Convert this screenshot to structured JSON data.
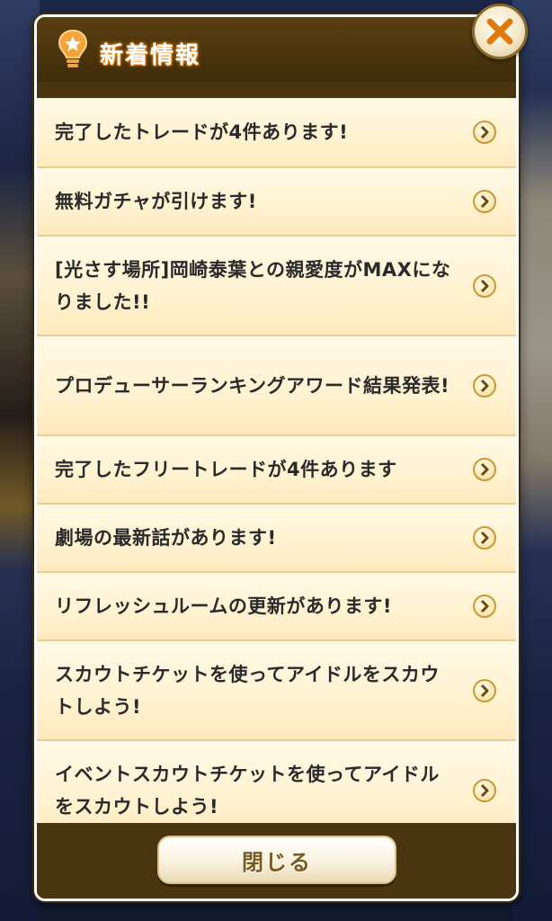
{
  "header": {
    "title": "新着情報",
    "icon": "lightbulb-star-icon"
  },
  "close_icon": "close-x-icon",
  "items": [
    {
      "label": "完了したトレードが4件あります!"
    },
    {
      "label": "無料ガチャが引けます!"
    },
    {
      "label": "[光さす場所]岡崎泰葉との親愛度がMAXになりました!!"
    },
    {
      "label": "プロデューサーランキングアワード結果発表!"
    },
    {
      "label": "完了したフリートレードが4件あります"
    },
    {
      "label": "劇場の最新話があります!"
    },
    {
      "label": "リフレッシュルームの更新があります!"
    },
    {
      "label": "スカウトチケットを使ってアイドルをスカウトしよう!"
    },
    {
      "label": "イベントスカウトチケットを使ってアイドルをスカウトしよう!"
    }
  ],
  "footer": {
    "close_label": "閉じる"
  },
  "colors": {
    "frame": "#4a3510",
    "item_bg": "#fff2d0",
    "title_glow": "#ff9a1a",
    "close_x": "#e07a10"
  }
}
